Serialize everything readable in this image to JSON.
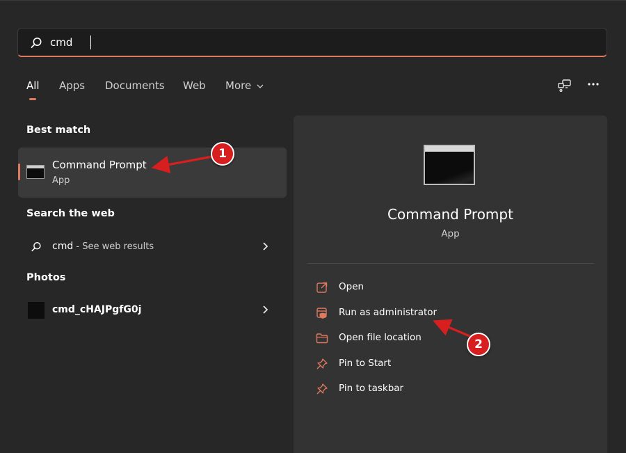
{
  "search": {
    "query": "cmd"
  },
  "tabs": [
    {
      "label": "All",
      "active": true
    },
    {
      "label": "Apps"
    },
    {
      "label": "Documents"
    },
    {
      "label": "Web"
    },
    {
      "label": "More"
    }
  ],
  "icons": {
    "share": "share-devices-icon",
    "more": "more-options-icon"
  },
  "left": {
    "best_match_title": "Best match",
    "best_match": {
      "title": "Command Prompt",
      "subtitle": "App"
    },
    "web_title": "Search the web",
    "web_result": {
      "term": "cmd",
      "suffix": " - See web results"
    },
    "photos_title": "Photos",
    "photo_result": {
      "name": "cmd_cHAJPgfG0j"
    }
  },
  "detail": {
    "title": "Command Prompt",
    "subtitle": "App",
    "actions": [
      {
        "label": "Open",
        "icon": "open-external-icon"
      },
      {
        "label": "Run as administrator",
        "icon": "admin-shield-icon"
      },
      {
        "label": "Open file location",
        "icon": "folder-icon"
      },
      {
        "label": "Pin to Start",
        "icon": "pin-icon"
      },
      {
        "label": "Pin to taskbar",
        "icon": "pin-icon"
      }
    ]
  },
  "annotations": [
    {
      "label": "1"
    },
    {
      "label": "2"
    }
  ],
  "colors": {
    "accent": "#e07a5f",
    "badge": "#d71f1f",
    "background": "#272727",
    "panel": "#333333"
  }
}
